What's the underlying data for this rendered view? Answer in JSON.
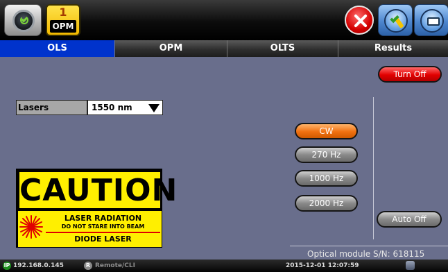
{
  "topbar": {
    "opm_tab_number": "1",
    "opm_tab_label": "OPM"
  },
  "tabs": [
    {
      "label": "OLS",
      "active": true
    },
    {
      "label": "OPM",
      "active": false
    },
    {
      "label": "OLTS",
      "active": false
    },
    {
      "label": "Results",
      "active": false
    }
  ],
  "controls": {
    "turn_off": "Turn Off",
    "cw": "CW",
    "hz270": "270 Hz",
    "hz1000": "1000 Hz",
    "hz2000": "2000 Hz",
    "auto_off": "Auto Off",
    "selected_modulation": "CW"
  },
  "lasers": {
    "label": "Lasers",
    "value": "1550 nm"
  },
  "caution": {
    "title": "CAUTION",
    "radiation": "LASER RADIATION",
    "warning": "DO NOT STARE INTO BEAM",
    "type": "DIODE LASER"
  },
  "module": {
    "serial_text": "Optical module S/N: 618115"
  },
  "statusbar": {
    "ip_badge": "IP",
    "ip": "192.168.0.145",
    "remote_badge": "R",
    "remote": "Remote/CLI",
    "datetime": "2015-12-01  12:07:59"
  },
  "colors": {
    "background": "#696e8c",
    "active_tab": "#0033cc",
    "selected_button": "#f07010",
    "turn_off_button": "#e20000",
    "caution_yellow": "#ffef00"
  },
  "icons": [
    "home-icon",
    "close-icon",
    "wizard-icon",
    "folder-icon",
    "laser-burst-icon",
    "status-icon"
  ]
}
